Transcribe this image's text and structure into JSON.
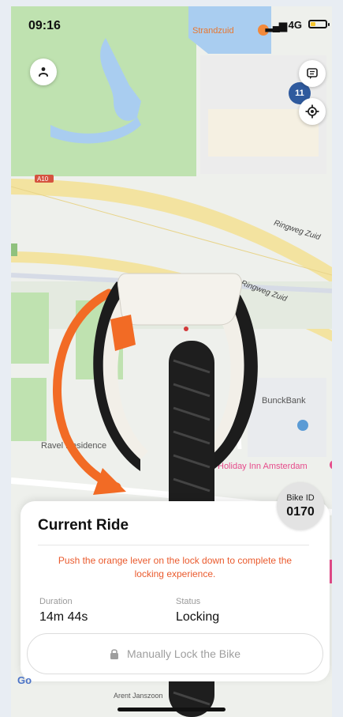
{
  "status_bar": {
    "time": "09:16",
    "signal": "▂▄▆",
    "network": "4G",
    "battery_level": 0.35
  },
  "map": {
    "places": {
      "strandzuid": "Strandzuid",
      "ravel": "Ravel Residence",
      "bunck": "BunckBank",
      "holiday_inn": "Holiday Inn Amsterdam",
      "street": "Arent Janszoon"
    },
    "roads": {
      "ringweg_1": "Ringweg Zuid",
      "ringweg_2": "Ringweg Zuid",
      "a10": "A10"
    },
    "cluster_count": "11"
  },
  "ride_card": {
    "title": "Current Ride",
    "instruction": "Push the orange lever on the lock down to complete the locking experience.",
    "duration_label": "Duration",
    "duration_value": "14m 44s",
    "status_label": "Status",
    "status_value": "Locking",
    "lock_button_label": "Manually Lock the Bike"
  },
  "bike_badge": {
    "label": "Bike ID",
    "value": "0170"
  },
  "colors": {
    "accent": "#ea5a2d",
    "map_green": "#bfe2b0",
    "water": "#a9cdf0",
    "road_yellow": "#f3e3a0",
    "lock_orange": "#f26b25"
  },
  "icons": {
    "profile": "person-icon",
    "chat": "message-icon",
    "locate": "locate-icon",
    "lock": "lock-icon",
    "rotate": "rotate-arrow-icon"
  }
}
